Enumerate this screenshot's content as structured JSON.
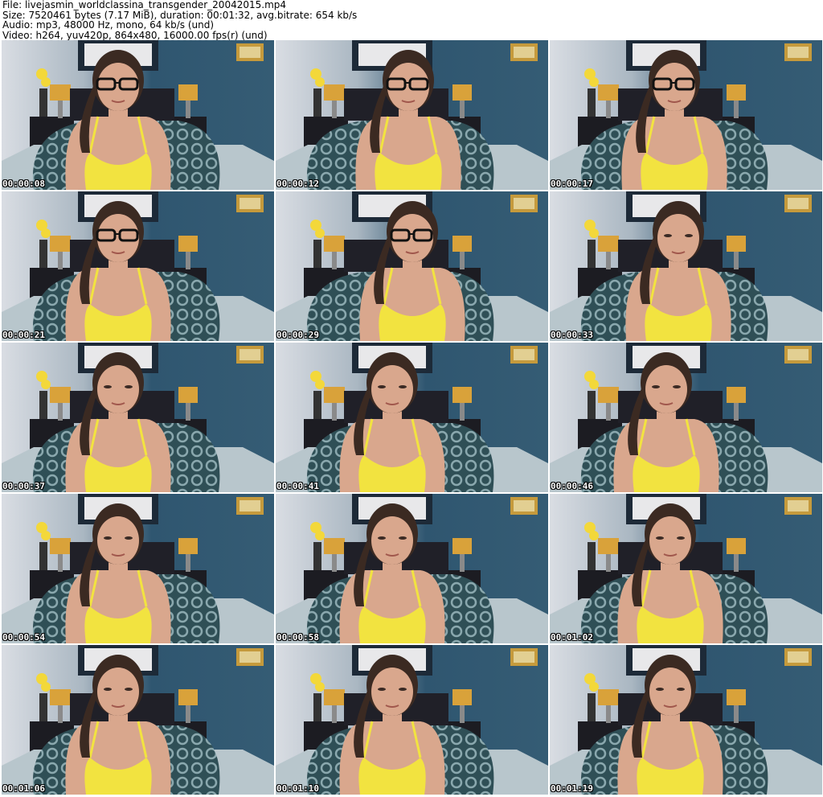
{
  "info": {
    "file": "File: livejasmin_worldclassina_transgender_20042015.mp4",
    "size": "Size: 7520461 bytes (7.17 MiB), duration: 00:01:32, avg.bitrate: 654 kb/s",
    "audio": "Audio: mp3, 48000 Hz, mono, 64 kb/s (und)",
    "video": "Video: h264, yuv420p, 864x480, 16000.00 fps(r) (und)"
  },
  "thumbnails": [
    {
      "timestamp": "00:00:08",
      "glasses": true
    },
    {
      "timestamp": "00:00:12",
      "glasses": true
    },
    {
      "timestamp": "00:00:17",
      "glasses": true
    },
    {
      "timestamp": "00:00:21",
      "glasses": true
    },
    {
      "timestamp": "00:00:29",
      "glasses": true
    },
    {
      "timestamp": "00:00:33",
      "glasses": false
    },
    {
      "timestamp": "00:00:37",
      "glasses": false
    },
    {
      "timestamp": "00:00:41",
      "glasses": false
    },
    {
      "timestamp": "00:00:46",
      "glasses": false
    },
    {
      "timestamp": "00:00:54",
      "glasses": false
    },
    {
      "timestamp": "00:00:58",
      "glasses": false
    },
    {
      "timestamp": "00:01:02",
      "glasses": false
    },
    {
      "timestamp": "00:01:06",
      "glasses": false
    },
    {
      "timestamp": "00:01:10",
      "glasses": false
    },
    {
      "timestamp": "00:01:19",
      "glasses": false
    }
  ],
  "colors": {
    "wall_left": "#d9dde3",
    "wall_right": "#2f5670",
    "top_dresses": "#f2e340",
    "skin": "#d9a78d",
    "hair": "#3b2a22",
    "bedspread": "#2f4f56"
  }
}
